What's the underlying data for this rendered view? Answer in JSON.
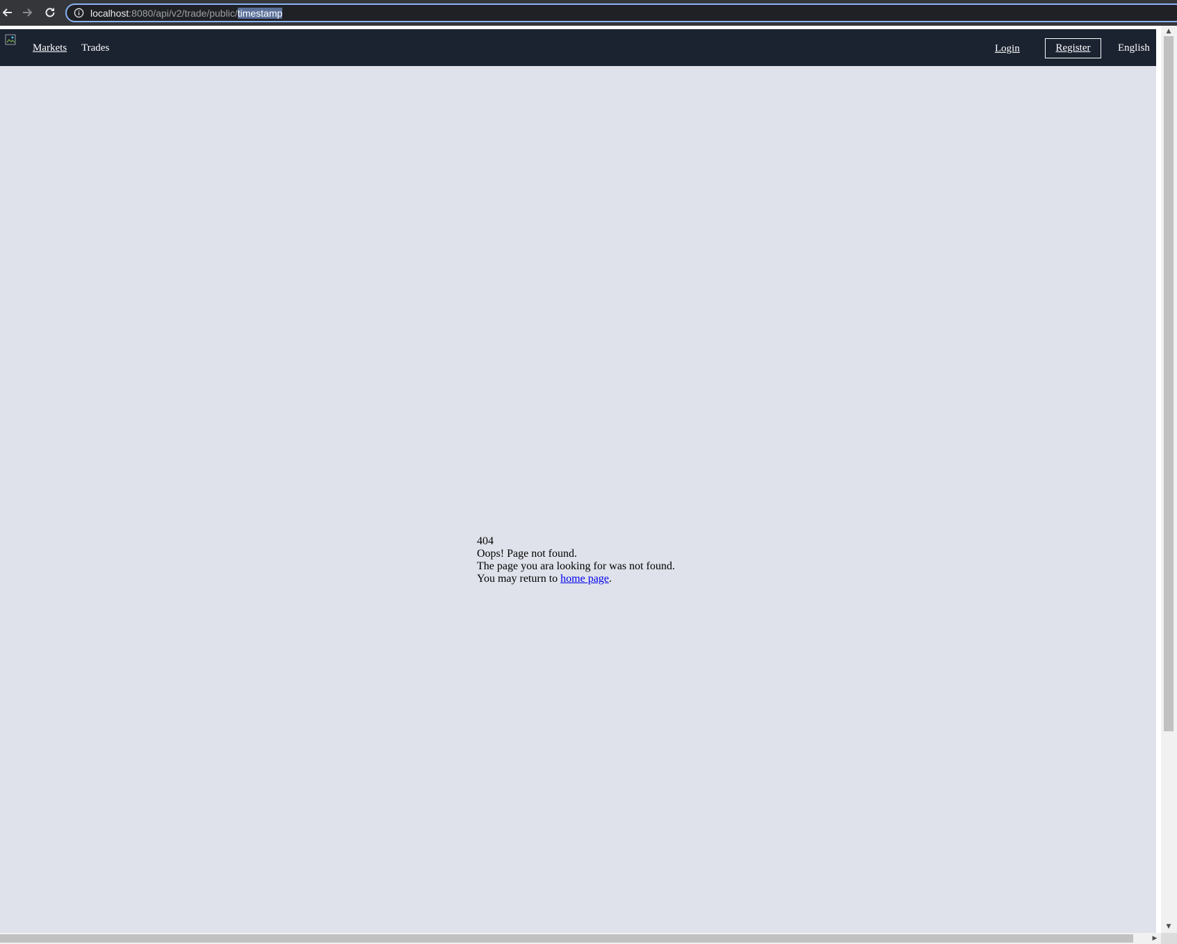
{
  "browser": {
    "url_host": "localhost",
    "url_path": ":8080/api/v2/trade/public/",
    "url_selected": "timestamp"
  },
  "header": {
    "nav": {
      "markets": "Markets",
      "trades": "Trades"
    },
    "auth": {
      "login": "Login",
      "register": "Register"
    },
    "language": "English"
  },
  "error": {
    "code": "404",
    "title": "Oops! Page not found.",
    "message": "The page you ara looking for was not found.",
    "return_prefix": "You may return to ",
    "home_link": "home page",
    "return_suffix": "."
  },
  "colors": {
    "header_bg": "#1b2230",
    "page_bg": "#dfe2ea",
    "link": "#0000ee"
  }
}
